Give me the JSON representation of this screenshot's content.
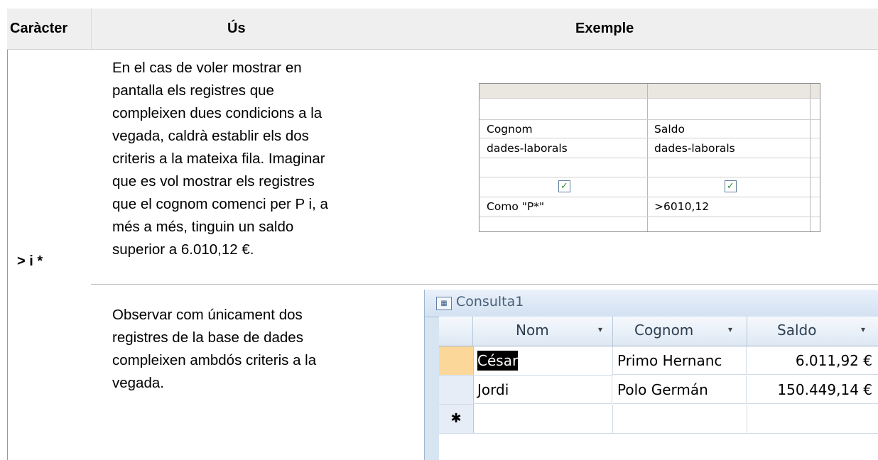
{
  "header": {
    "col_caracter": "Caràcter",
    "col_us": "Ús",
    "col_exemple": "Exemple"
  },
  "row": {
    "caracter": "> i *",
    "paragraph1_lines": [
      "En el cas de voler mostrar en",
      "pantalla els registres que",
      "compleixen dues condicions a la",
      "vegada, caldrà establir els dos",
      "criteris a la mateixa fila. Imaginar",
      "que es vol mostrar els registres",
      "que el cognom comenci per P i, a",
      "més a més, tinguin un saldo",
      "superior a 6.010,12 €."
    ],
    "paragraph2_lines": [
      "Observar com únicament dos",
      "registres de la base de dades",
      "compleixen ambdós criteris a la",
      "vegada."
    ]
  },
  "criteria_grid": {
    "col1": {
      "field": "Cognom",
      "table": "dades-laborals",
      "show": "✓",
      "criteria": "Como \"P*\""
    },
    "col2": {
      "field": "Saldo",
      "table": "dades-laborals",
      "show": "✓",
      "criteria": ">6010,12"
    }
  },
  "query": {
    "title": "Consulta1",
    "icon": "query-icon",
    "columns": [
      "Nom",
      "Cognom",
      "Saldo"
    ],
    "dropdown_glyph": "▾",
    "rows": [
      {
        "nom": "César",
        "cognom": "Primo Hernanc",
        "saldo": "6.011,92 €"
      },
      {
        "nom": "Jordi",
        "cognom": "Polo Germán",
        "saldo": "150.449,14 €"
      }
    ],
    "new_row_marker": "✱"
  },
  "colors": {
    "header_bg": "#efefef",
    "selected_row": "#fbd89a",
    "selected_cell": "#000000",
    "check_green": "#2f8f2f"
  }
}
